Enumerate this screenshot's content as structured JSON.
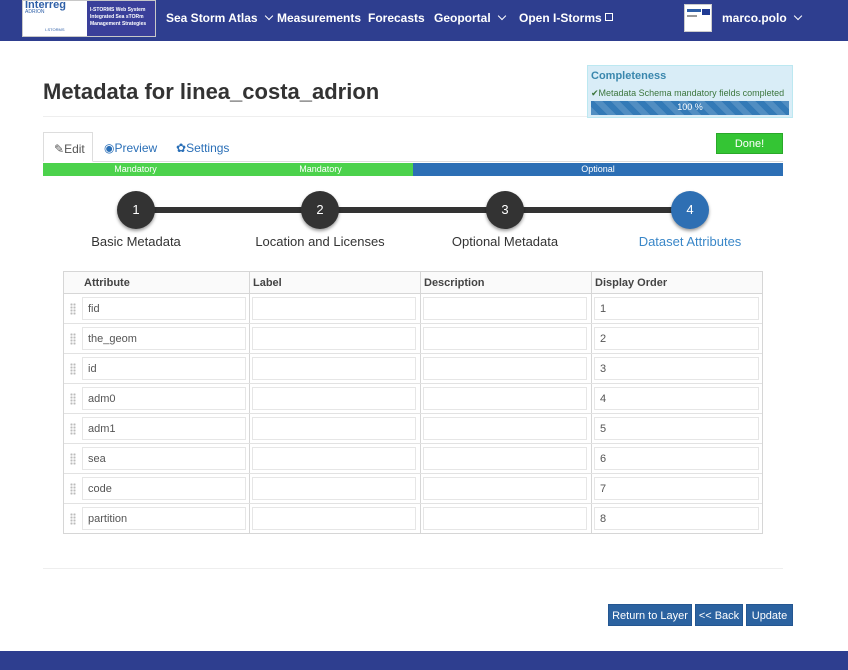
{
  "navbar": {
    "logo": {
      "text_left_1": "Interreg",
      "text_left_2": "ADRION",
      "text_left_3": "I-STORMS",
      "text_right_1": "I-STORMS Web System",
      "text_right_2": "Integrated Sea sTORm",
      "text_right_3": "Management Strategies"
    },
    "items": [
      {
        "label": "Sea Storm Atlas",
        "dropdown": true
      },
      {
        "label": "Measurements",
        "dropdown": false
      },
      {
        "label": "Forecasts",
        "dropdown": false
      },
      {
        "label": "Geoportal",
        "dropdown": true
      },
      {
        "label": "Open I-Storms",
        "dropdown": false,
        "external_icon": "external-link-icon"
      }
    ],
    "user": {
      "name": "marco.polo",
      "dropdown": true
    },
    "colors": {
      "bar": "#2e3e8f"
    }
  },
  "page": {
    "title": "Metadata for linea_costa_adrion"
  },
  "completeness": {
    "title": "Completeness",
    "subtitle": "Metadata Schema mandatory fields completed",
    "check_icon": "check-icon",
    "progress_text": "100 %",
    "progress_value": 100
  },
  "tabs": [
    {
      "label": "Edit",
      "icon": "pencil-icon",
      "active": true
    },
    {
      "label": "Preview",
      "icon": "camera-icon",
      "active": false
    },
    {
      "label": "Settings",
      "icon": "gear-icon",
      "active": false
    }
  ],
  "done_button": "Done!",
  "segments": [
    {
      "label": "Mandatory",
      "type": "mandatory"
    },
    {
      "label": "Mandatory",
      "type": "mandatory"
    },
    {
      "label": "Optional",
      "type": "optional"
    }
  ],
  "steps": [
    {
      "number": "1",
      "label": "Basic Metadata",
      "active": false
    },
    {
      "number": "2",
      "label": "Location and Licenses",
      "active": false
    },
    {
      "number": "3",
      "label": "Optional Metadata",
      "active": false
    },
    {
      "number": "4",
      "label": "Dataset Attributes",
      "active": true
    }
  ],
  "table": {
    "columns": [
      "Attribute",
      "Label",
      "Description",
      "Display Order"
    ],
    "rows": [
      {
        "attribute": "fid",
        "label": "",
        "description": "",
        "order": "1"
      },
      {
        "attribute": "the_geom",
        "label": "",
        "description": "",
        "order": "2"
      },
      {
        "attribute": "id",
        "label": "",
        "description": "",
        "order": "3"
      },
      {
        "attribute": "adm0",
        "label": "",
        "description": "",
        "order": "4"
      },
      {
        "attribute": "adm1",
        "label": "",
        "description": "",
        "order": "5"
      },
      {
        "attribute": "sea",
        "label": "",
        "description": "",
        "order": "6"
      },
      {
        "attribute": "code",
        "label": "",
        "description": "",
        "order": "7"
      },
      {
        "attribute": "partition",
        "label": "",
        "description": "",
        "order": "8"
      }
    ]
  },
  "actions": {
    "return": "Return to Layer",
    "back": "<< Back",
    "update": "Update"
  }
}
